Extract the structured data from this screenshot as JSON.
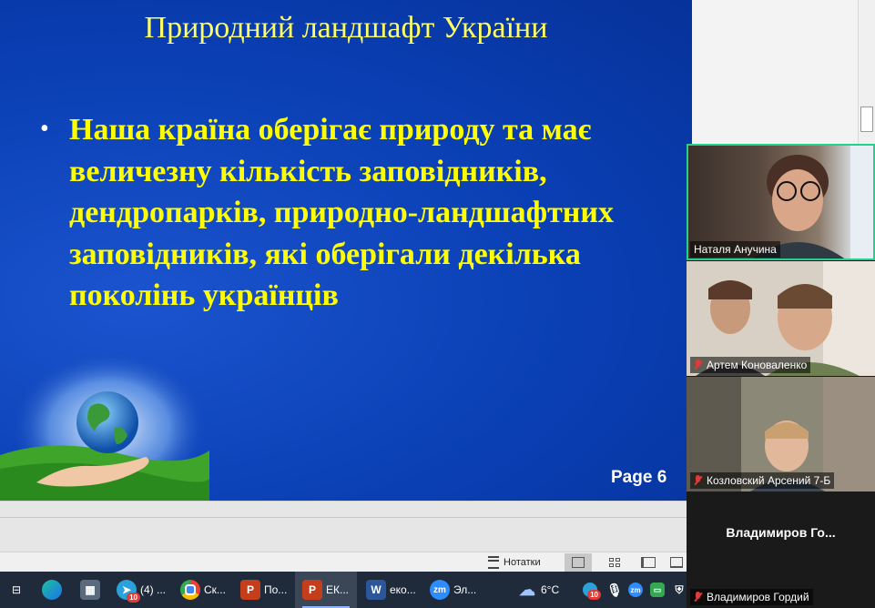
{
  "slide": {
    "title": "Природний ландшафт України",
    "bullet_marker": "•",
    "bullet_text": "Наша країна оберігає природу та має величезну кількість заповідників, дендропарків, природно-ландшафтних заповідників, які оберігали декілька поколінь українців",
    "page_label": "Page 6",
    "colors": {
      "background": "#0a3fb4",
      "title": "#ffff66",
      "bullet": "#ffff00"
    }
  },
  "statusbar": {
    "notes_label": "Нотатки",
    "views": [
      "normal-view",
      "slide-sorter",
      "reading-view",
      "slideshow"
    ]
  },
  "taskbar": {
    "items": [
      {
        "icon": "task-view-icon",
        "label": ""
      },
      {
        "icon": "edge-icon",
        "label": ""
      },
      {
        "icon": "calculator-icon",
        "label": ""
      },
      {
        "icon": "telegram-icon",
        "label": "(4) ...",
        "badge": "10"
      },
      {
        "icon": "chrome-icon",
        "label": "Ск..."
      },
      {
        "icon": "powerpoint-icon",
        "label": "По..."
      },
      {
        "icon": "powerpoint-icon",
        "label": "ЕК..."
      },
      {
        "icon": "word-icon",
        "label": "еко..."
      },
      {
        "icon": "zoom-icon",
        "label": "Эл..."
      }
    ],
    "weather": "6°C",
    "tray_badge": "10"
  },
  "participants": [
    {
      "name": "Наталя Анучина",
      "muted": false,
      "active_speaker": true
    },
    {
      "name": "Артем Коноваленко",
      "muted": true,
      "active_speaker": false
    },
    {
      "name": "Козловский Арсений 7-Б",
      "muted": true,
      "active_speaker": false
    },
    {
      "name": "Владимиров Гордий",
      "display_title": "Владимиров  Го...",
      "muted": true,
      "active_speaker": false
    }
  ]
}
